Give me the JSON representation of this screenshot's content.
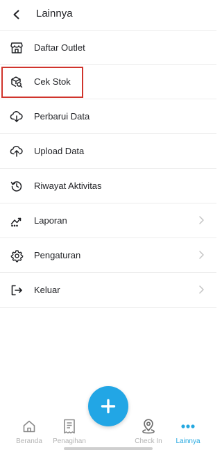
{
  "header": {
    "title": "Lainnya",
    "back_icon": "chevron-left-icon"
  },
  "menu": {
    "items": [
      {
        "label": "Daftar Outlet",
        "icon": "store-icon",
        "has_chevron": false
      },
      {
        "label": "Cek Stok",
        "icon": "box-search-icon",
        "has_chevron": false,
        "highlighted": true
      },
      {
        "label": "Perbarui Data",
        "icon": "cloud-download-icon",
        "has_chevron": false
      },
      {
        "label": "Upload Data",
        "icon": "cloud-upload-icon",
        "has_chevron": false
      },
      {
        "label": "Riwayat Aktivitas",
        "icon": "history-icon",
        "has_chevron": false
      },
      {
        "label": "Laporan",
        "icon": "chart-line-icon",
        "has_chevron": true
      },
      {
        "label": "Pengaturan",
        "icon": "gear-icon",
        "has_chevron": true
      },
      {
        "label": "Keluar",
        "icon": "logout-icon",
        "has_chevron": true
      }
    ]
  },
  "bottom_nav": {
    "items": [
      {
        "label": "Beranda",
        "icon": "home-icon",
        "active": false
      },
      {
        "label": "Penagihan",
        "icon": "receipt-icon",
        "active": false
      },
      {
        "label": "Check In",
        "icon": "map-pin-icon",
        "active": false
      },
      {
        "label": "Lainnya",
        "icon": "more-dots-icon",
        "active": true
      }
    ]
  },
  "fab": {
    "icon": "plus-icon"
  },
  "colors": {
    "accent": "#22a6e5",
    "highlight_box": "#d0342c",
    "inactive_nav": "#b3b3b3",
    "text": "#1f2024",
    "divider": "#ececec"
  }
}
